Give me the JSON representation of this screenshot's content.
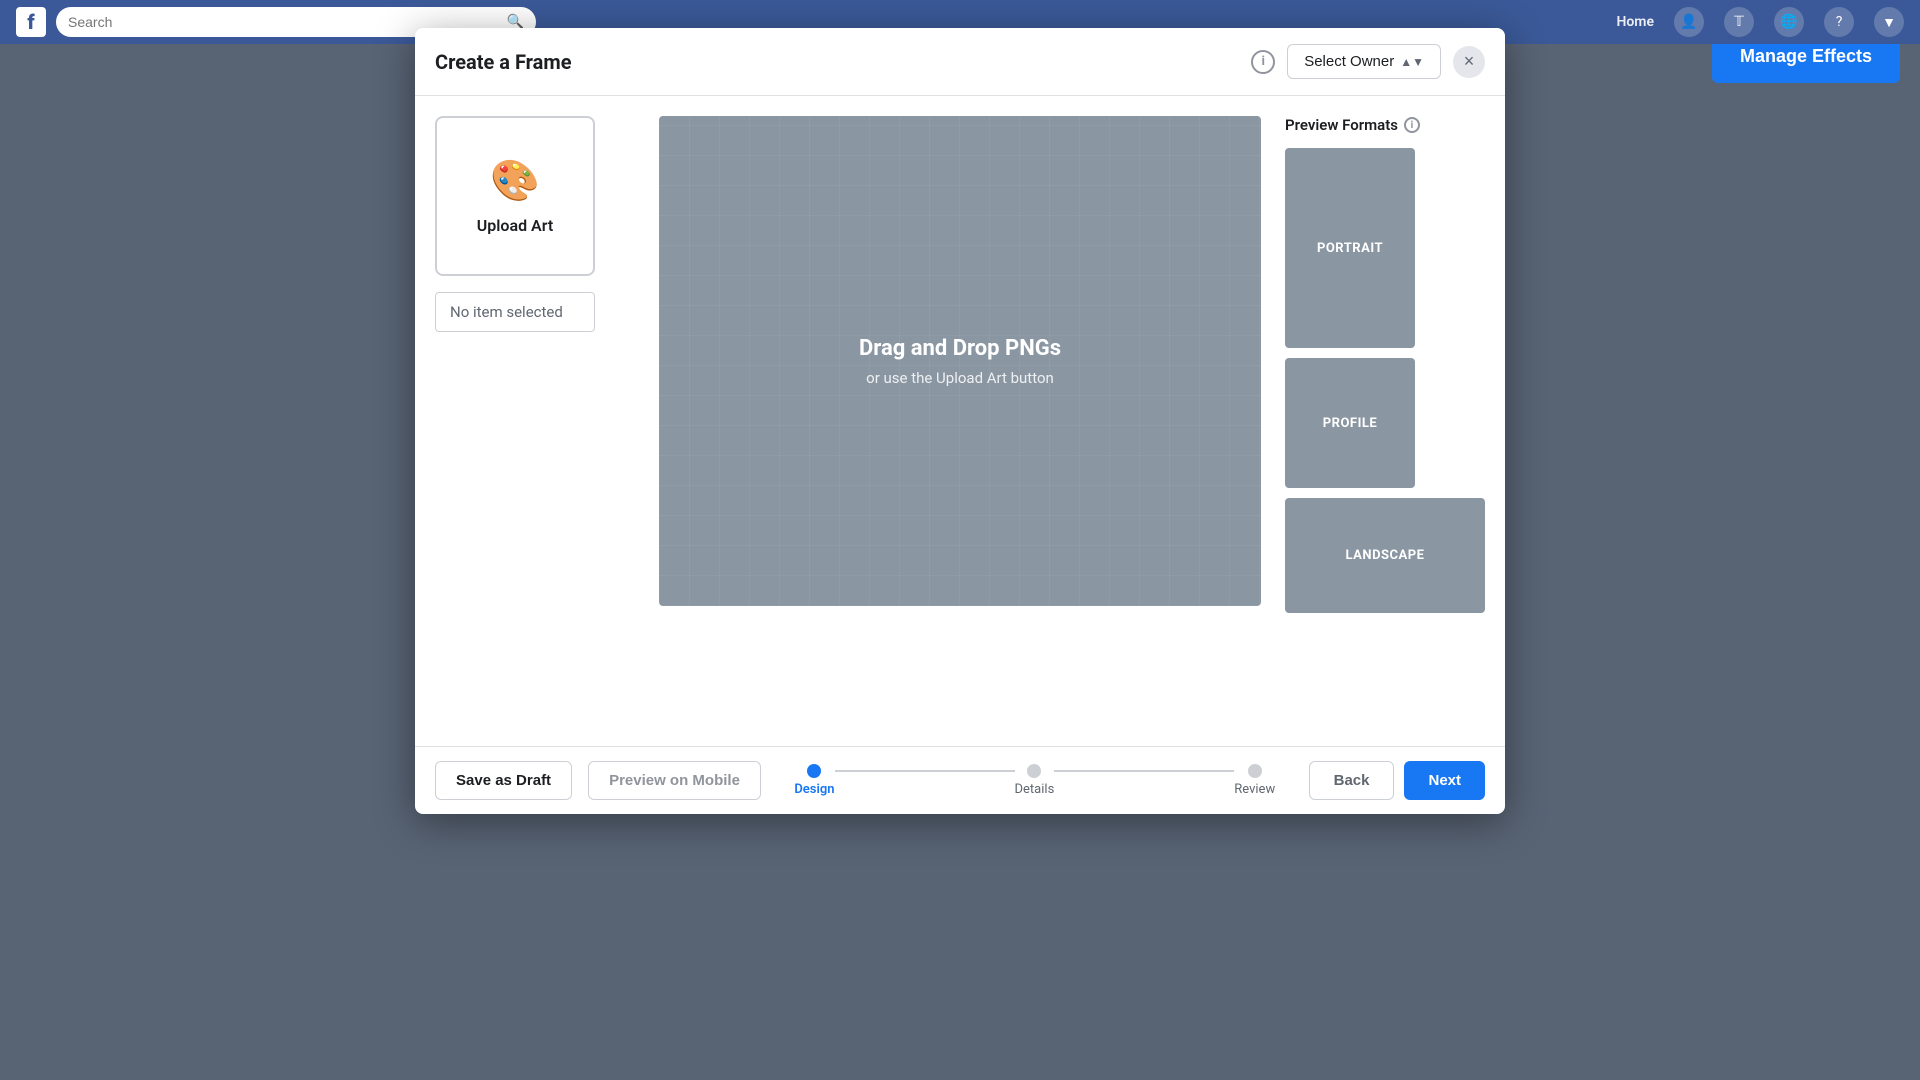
{
  "topnav": {
    "logo": "f",
    "search_placeholder": "Search",
    "home_label": "Home"
  },
  "manage_effects": {
    "label": "Manage Effects"
  },
  "modal": {
    "title": "Create a Frame",
    "select_owner_label": "Select Owner",
    "close_icon": "×",
    "info_icon": "i",
    "upload_art_label": "Upload Art",
    "no_item_label": "No item selected",
    "dropzone": {
      "title": "Drag and Drop PNGs",
      "subtitle": "or use the Upload Art button"
    },
    "preview_formats": {
      "label": "Preview Formats",
      "portrait_label": "PORTRAIT",
      "profile_label": "PROFILE",
      "landscape_label": "LANDSCAPE"
    },
    "footer": {
      "save_draft_label": "Save as Draft",
      "preview_mobile_label": "Preview on Mobile",
      "back_label": "Back",
      "next_label": "Next",
      "steps": [
        {
          "label": "Design",
          "active": true
        },
        {
          "label": "Details",
          "active": false
        },
        {
          "label": "Review",
          "active": false
        }
      ]
    }
  }
}
